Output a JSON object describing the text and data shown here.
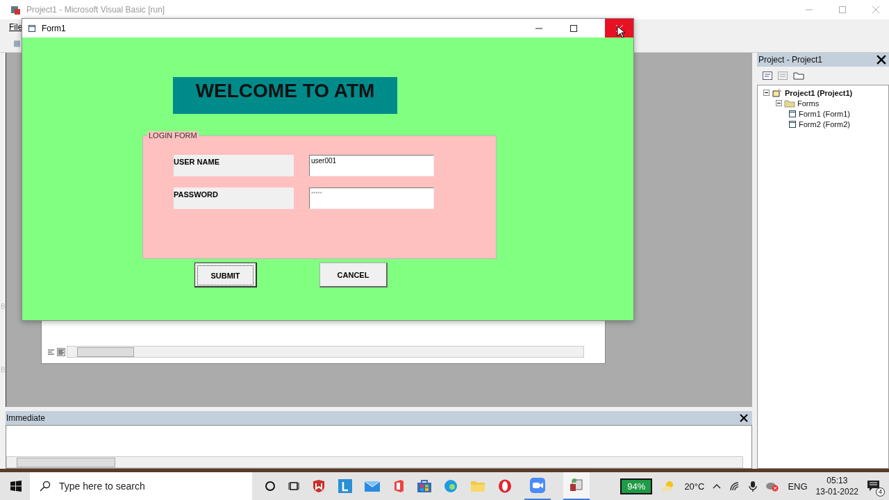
{
  "ide": {
    "title": "Project1 - Microsoft Visual Basic [run]",
    "menu": [
      "File"
    ],
    "edge_labels": [
      "B",
      "B"
    ]
  },
  "form": {
    "title": "Form1",
    "banner": "WELCOME TO ATM",
    "frame_title": "LOGIN FORM",
    "fields": [
      {
        "label": "USER NAME",
        "value": "user001"
      },
      {
        "label": "PASSWORD",
        "value": "*****"
      }
    ],
    "buttons": [
      {
        "label": "SUBMIT",
        "focused": true
      },
      {
        "label": "CANCEL",
        "focused": false
      }
    ]
  },
  "project_panel": {
    "title": "Project - Project1",
    "tree": [
      {
        "label": "Project1 (Project1)",
        "expanded": true,
        "children": [
          {
            "label": "Forms",
            "expanded": true,
            "children": [
              {
                "label": "Form1 (Form1)"
              },
              {
                "label": "Form2 (Form2)"
              }
            ]
          }
        ]
      }
    ]
  },
  "immediate": {
    "title": "Immediate"
  },
  "taskbar": {
    "search": {
      "placeholder": "Type here to search"
    },
    "battery": "94%",
    "temperature": "20°C",
    "language": "ENG",
    "time": "05:13",
    "date": "13-01-2022",
    "notifications": "4"
  }
}
